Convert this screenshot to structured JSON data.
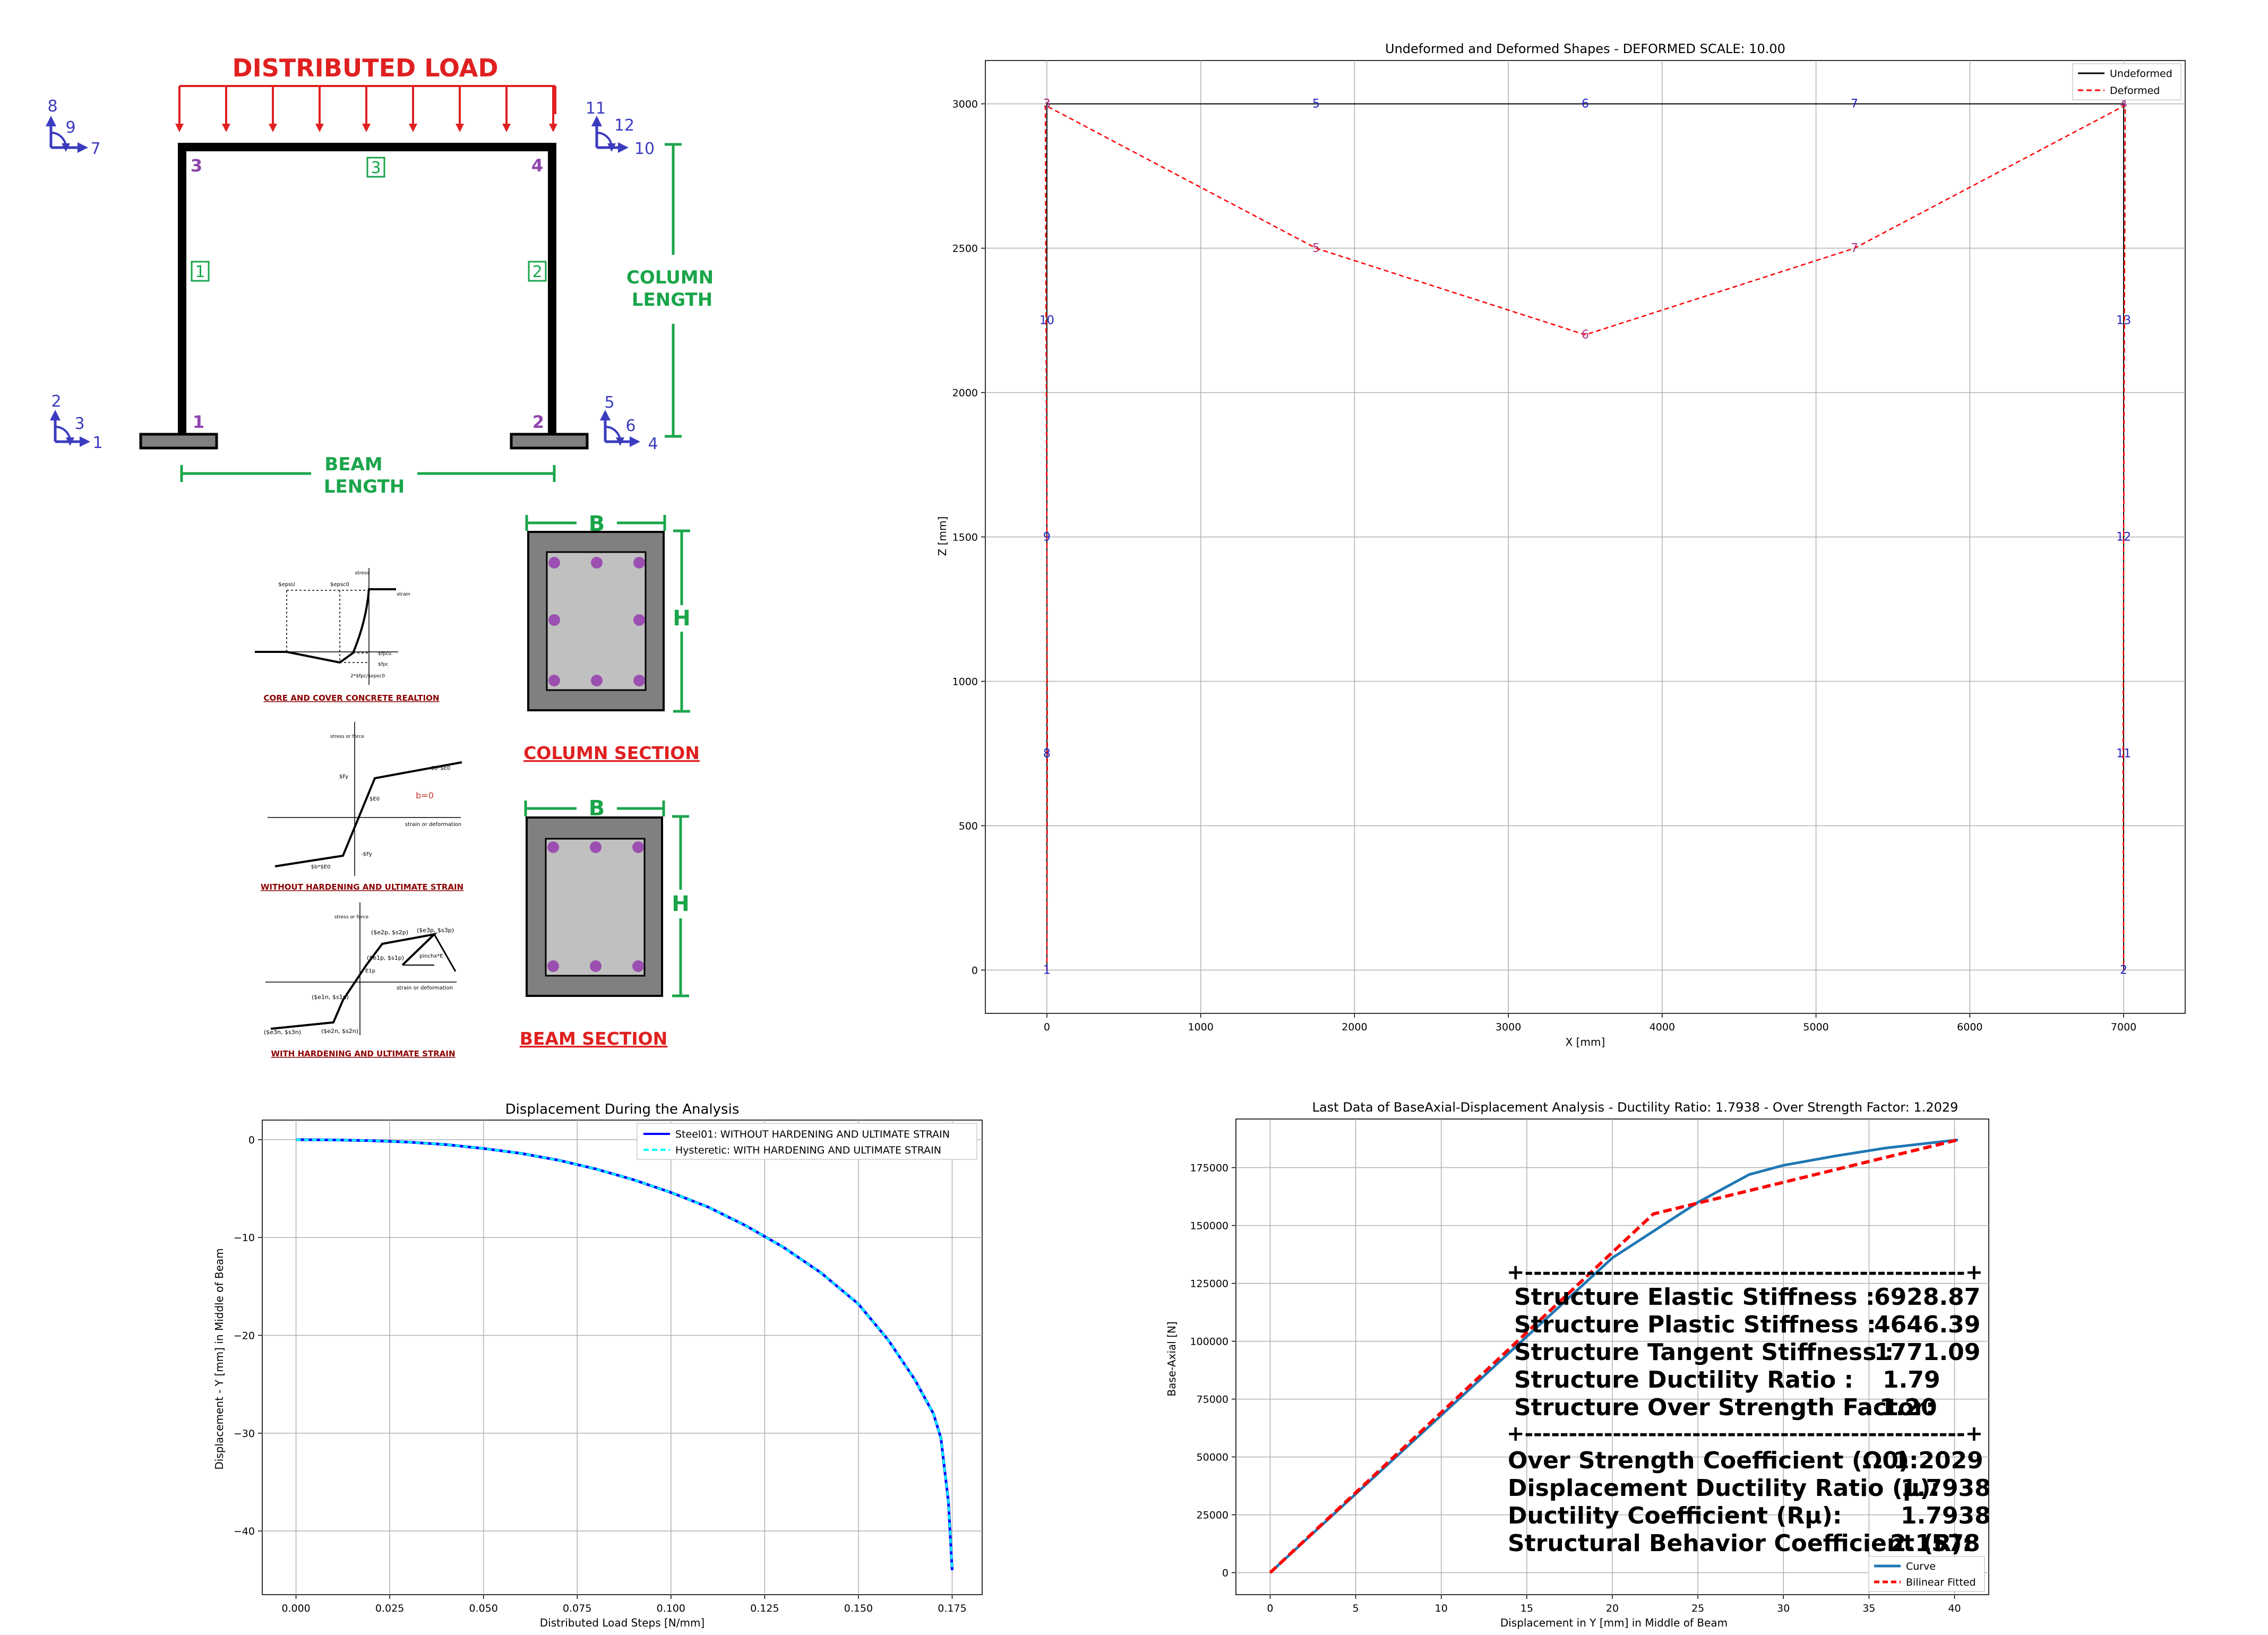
{
  "colors": {
    "blue": "#3b3bbf",
    "green": "#1aa54a",
    "red": "#e02020",
    "purple": "#8e44ad",
    "dark_red": "#8b0000",
    "undeformed": "#000000",
    "deformed": "#ff0000",
    "steel01": "#0000ff",
    "hysteretic": "#00ffff",
    "curve": "#1f77b4",
    "bilinear": "#ff0000",
    "section_gray": "#808080",
    "core_gray": "#c0c0c0"
  },
  "frame_diagram": {
    "title": "DISTRIBUTED LOAD",
    "column_length_line1": "COLUMN",
    "column_length_line2": "LENGTH",
    "beam_length_line1": "BEAM",
    "beam_length_line2": "LENGTH",
    "node_labels": [
      "1",
      "2",
      "3",
      "4"
    ],
    "element_labels": [
      "1",
      "2",
      "3"
    ],
    "dof_node_3": [
      "8",
      "9",
      "7"
    ],
    "dof_node_4": [
      "11",
      "12",
      "10"
    ],
    "dof_node_1": [
      "2",
      "3",
      "1"
    ],
    "dof_node_2": [
      "5",
      "6",
      "4"
    ]
  },
  "sections": {
    "b_label": "B",
    "h_label": "H",
    "column_caption": "COLUMN SECTION",
    "beam_caption": "BEAM SECTION"
  },
  "materials": {
    "concrete_caption": "CORE AND COVER CONCRETE REALTION",
    "concrete_labels": [
      "$epsU",
      "$epsc0",
      "stress",
      "strain",
      "$fpcu",
      "$fpc",
      "2*$fpc/$epsc0"
    ],
    "steel_caption": "WITHOUT HARDENING AND ULTIMATE STRAIN",
    "steel_labels": [
      "stress or force",
      "$b*$E0",
      "$Fy",
      "$E0",
      "b=0",
      "strain or deformation",
      "-$Fy",
      "$b*$E0"
    ],
    "hyst_caption": "WITH HARDENING AND ULTIMATE STRAIN",
    "hyst_labels": [
      "stress or force",
      "($e2p, $s2p)",
      "($e3p, $s3p)",
      "($e1p, $s1p)",
      "E1p",
      "pinchx*E",
      "strain or deformation",
      "($e1n, $s1n)",
      "($e3n, $s3n)",
      "($e2n, $s2n)"
    ]
  },
  "chart_data": [
    {
      "type": "line",
      "title": "Undeformed and Deformed Shapes - DEFORMED SCALE: 10.00",
      "xlabel": "X [mm]",
      "ylabel": "Z [mm]",
      "xlim": [
        -400,
        7400
      ],
      "ylim": [
        -150,
        3150
      ],
      "xticks": [
        0,
        1000,
        2000,
        3000,
        4000,
        5000,
        6000,
        7000
      ],
      "yticks": [
        0,
        500,
        1000,
        1500,
        2000,
        2500,
        3000
      ],
      "grid": true,
      "legend": "top-right",
      "series": [
        {
          "name": "Undeformed",
          "style": "solid",
          "x": [
            0,
            0,
            0,
            0,
            0,
            1750,
            3500,
            5250,
            7000,
            7000,
            7000,
            7000,
            7000
          ],
          "y": [
            0,
            750,
            1500,
            2250,
            3000,
            3000,
            3000,
            3000,
            3000,
            2250,
            1500,
            750,
            0
          ]
        },
        {
          "name": "Deformed",
          "style": "dashed",
          "x": [
            0,
            3,
            0,
            -5,
            -10,
            1750,
            3500,
            5250,
            7010,
            7005,
            7000,
            6997,
            7000
          ],
          "y": [
            0,
            750,
            1500,
            2250,
            2995,
            2500,
            2200,
            2500,
            2995,
            2250,
            1500,
            750,
            0
          ]
        }
      ],
      "undeformed_node_labels": [
        {
          "label": "1",
          "x": 0,
          "y": 0
        },
        {
          "label": "8",
          "x": 0,
          "y": 750
        },
        {
          "label": "9",
          "x": 0,
          "y": 1500
        },
        {
          "label": "10",
          "x": 0,
          "y": 2250
        },
        {
          "label": "3",
          "x": 0,
          "y": 3000
        },
        {
          "label": "5",
          "x": 1750,
          "y": 3000
        },
        {
          "label": "6",
          "x": 3500,
          "y": 3000
        },
        {
          "label": "7",
          "x": 5250,
          "y": 3000
        },
        {
          "label": "4",
          "x": 7000,
          "y": 3000
        },
        {
          "label": "13",
          "x": 7000,
          "y": 2250
        },
        {
          "label": "12",
          "x": 7000,
          "y": 1500
        },
        {
          "label": "11",
          "x": 7000,
          "y": 750
        },
        {
          "label": "2",
          "x": 7000,
          "y": 0
        }
      ],
      "deformed_node_labels": [
        {
          "label": "5",
          "x": 1750,
          "y": 2500
        },
        {
          "label": "6",
          "x": 3500,
          "y": 2200
        },
        {
          "label": "7",
          "x": 5250,
          "y": 2500
        },
        {
          "label": "3",
          "x": 0,
          "y": 3000
        },
        {
          "label": "4",
          "x": 7000,
          "y": 3000
        }
      ]
    },
    {
      "type": "line",
      "title": "Displacement During the Analysis",
      "xlabel": "Distributed Load Steps [N/mm]",
      "ylabel": "Displacement - Y [mm] in Middle of Beam",
      "xlim": [
        -0.009,
        0.183
      ],
      "ylim": [
        -46.5,
        2
      ],
      "xticks": [
        "0.000",
        "0.025",
        "0.050",
        "0.075",
        "0.100",
        "0.125",
        "0.150",
        "0.175"
      ],
      "yticks": [
        0,
        -10,
        -20,
        -30,
        -40
      ],
      "grid": true,
      "legend": "top-right",
      "series": [
        {
          "name": "Steel01: WITHOUT HARDENING AND ULTIMATE STRAIN",
          "style": "solid",
          "x": [
            0,
            0.01,
            0.02,
            0.03,
            0.04,
            0.05,
            0.06,
            0.07,
            0.08,
            0.09,
            0.1,
            0.11,
            0.12,
            0.13,
            0.14,
            0.15,
            0.158,
            0.165,
            0.17,
            0.172,
            0.174,
            0.175
          ],
          "y": [
            0,
            -0.03,
            -0.1,
            -0.25,
            -0.5,
            -0.9,
            -1.4,
            -2.1,
            -3.0,
            -4.1,
            -5.4,
            -6.9,
            -8.8,
            -11.0,
            -13.6,
            -16.8,
            -20.5,
            -24.5,
            -28.0,
            -30.5,
            -37.0,
            -44.0
          ]
        },
        {
          "name": "Hysteretic: WITH HARDENING AND ULTIMATE STRAIN",
          "style": "dashed",
          "x": [
            0,
            0.01,
            0.02,
            0.03,
            0.04,
            0.05,
            0.06,
            0.07,
            0.08,
            0.09,
            0.1,
            0.11,
            0.12,
            0.13,
            0.14,
            0.15,
            0.158,
            0.165,
            0.17,
            0.172,
            0.174,
            0.175
          ],
          "y": [
            0,
            -0.03,
            -0.1,
            -0.25,
            -0.5,
            -0.9,
            -1.4,
            -2.1,
            -3.0,
            -4.1,
            -5.4,
            -6.9,
            -8.8,
            -11.0,
            -13.6,
            -16.8,
            -20.5,
            -24.5,
            -28.0,
            -30.5,
            -37.0,
            -44.0
          ]
        }
      ]
    },
    {
      "type": "line",
      "title": "Last Data of BaseAxial-Displacement Analysis - Ductility Ratio: 1.7938 - Over Strength Factor: 1.2029",
      "xlabel": "Displacement in Y [mm] in Middle of Beam",
      "ylabel": "Base-Axial [N]",
      "xlim": [
        -2,
        42
      ],
      "ylim": [
        -9500,
        196000
      ],
      "xticks": [
        0,
        5,
        10,
        15,
        20,
        25,
        30,
        35,
        40
      ],
      "yticks": [
        0,
        25000,
        50000,
        75000,
        100000,
        125000,
        150000,
        175000
      ],
      "grid": true,
      "legend": "bottom-right",
      "series": [
        {
          "name": "Curve",
          "style": "solid",
          "x": [
            0,
            5,
            10,
            15,
            20,
            25,
            28,
            30,
            33,
            36,
            40.2
          ],
          "y": [
            0,
            34000,
            68000,
            102000,
            136000,
            160000,
            172000,
            176000,
            180000,
            183500,
            187000
          ]
        },
        {
          "name": "Bilinear Fitted",
          "style": "dashed",
          "x": [
            0,
            22.4,
            40.2
          ],
          "y": [
            0,
            155000,
            187000
          ]
        }
      ],
      "summary_box": {
        "separator": "+--------------------------------------------------+",
        "rows": [
          {
            "label": "Structure Elastic Stiffness :",
            "value": "6928.87"
          },
          {
            "label": "Structure Plastic Stiffness :",
            "value": "4646.39"
          },
          {
            "label": "Structure Tangent Stiffness :",
            "value": "1771.09"
          },
          {
            "label": "Structure Ductility Ratio :",
            "value": "1.79"
          },
          {
            "label": "Structure Over Strength Factor:",
            "value": "1.20"
          }
        ],
        "coeffs": [
          {
            "label": "Over Strength Coefficient (Ω0):",
            "value": "1.2029"
          },
          {
            "label": "Displacement Ductility Ratio (μ):",
            "value": "1.7938"
          },
          {
            "label": "Ductility Coefficient (Rμ):",
            "value": "1.7938"
          },
          {
            "label": "Structural Behavior Coefficient (R):",
            "value": "2.1578"
          }
        ]
      }
    }
  ]
}
